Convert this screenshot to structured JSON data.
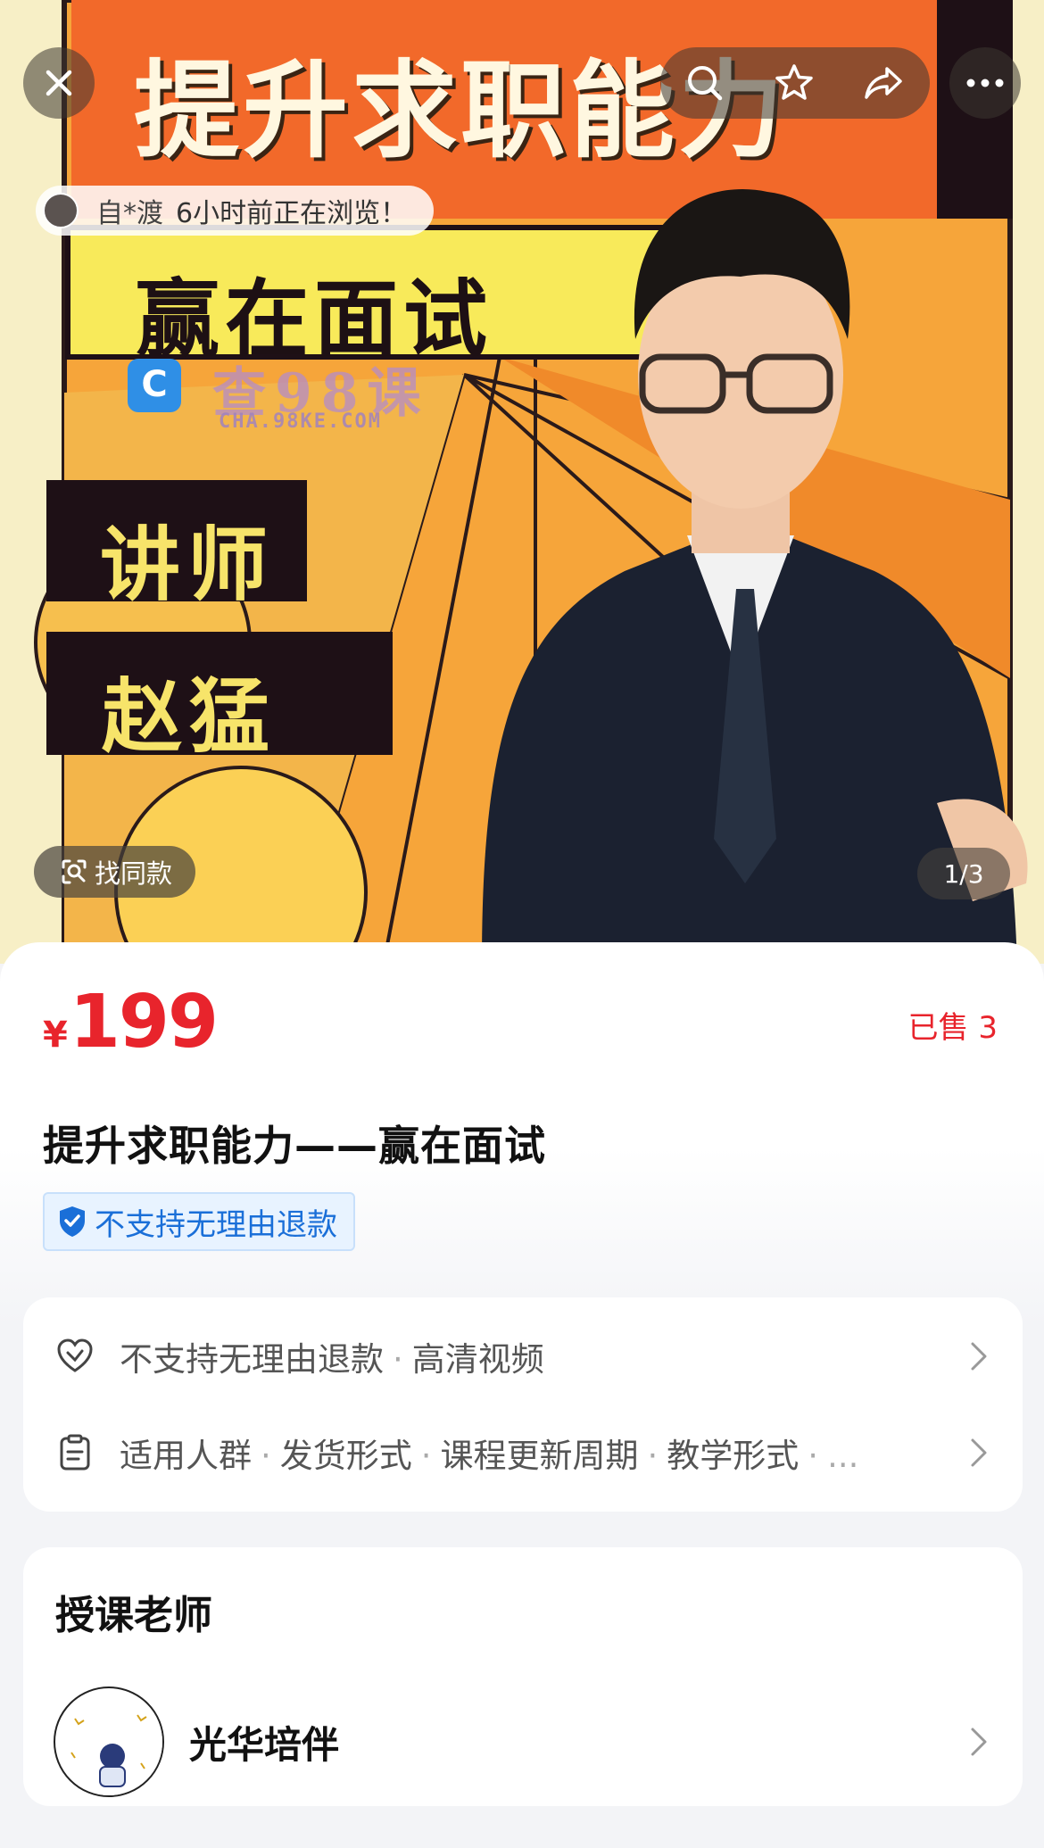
{
  "hero": {
    "title": "提升求职能力",
    "subtitle": "赢在面试",
    "label_1": "讲师",
    "label_2": "赵猛",
    "watermark_name": "查98课",
    "watermark_url": "CHA.98KE.COM",
    "browsing": {
      "name": "自*渡",
      "text": "6小时前正在浏览！"
    },
    "find_same_label": "找同款",
    "pager": "1/3"
  },
  "nav": {
    "icons": [
      "close-icon",
      "search-icon",
      "star-icon",
      "share-icon",
      "more-icon"
    ]
  },
  "product": {
    "price_symbol": "¥",
    "price": "199",
    "sold": "已售 3",
    "title": "提升求职能力——赢在面试",
    "badge": "不支持无理由退款"
  },
  "info": {
    "row1": {
      "item1": "不支持无理由退款",
      "sep": "·",
      "item2": "高清视频"
    },
    "row2": {
      "item1": "适用人群",
      "item2": "发货形式",
      "item3": "课程更新周期",
      "item4": "教学形式",
      "sep": "·",
      "ellipsis": "..."
    }
  },
  "teacher": {
    "heading": "授课老师",
    "name": "光华培伴"
  },
  "colors": {
    "price": "#e8242c",
    "badge_text": "#1a6fd8",
    "badge_bg": "#e8f3ff"
  }
}
